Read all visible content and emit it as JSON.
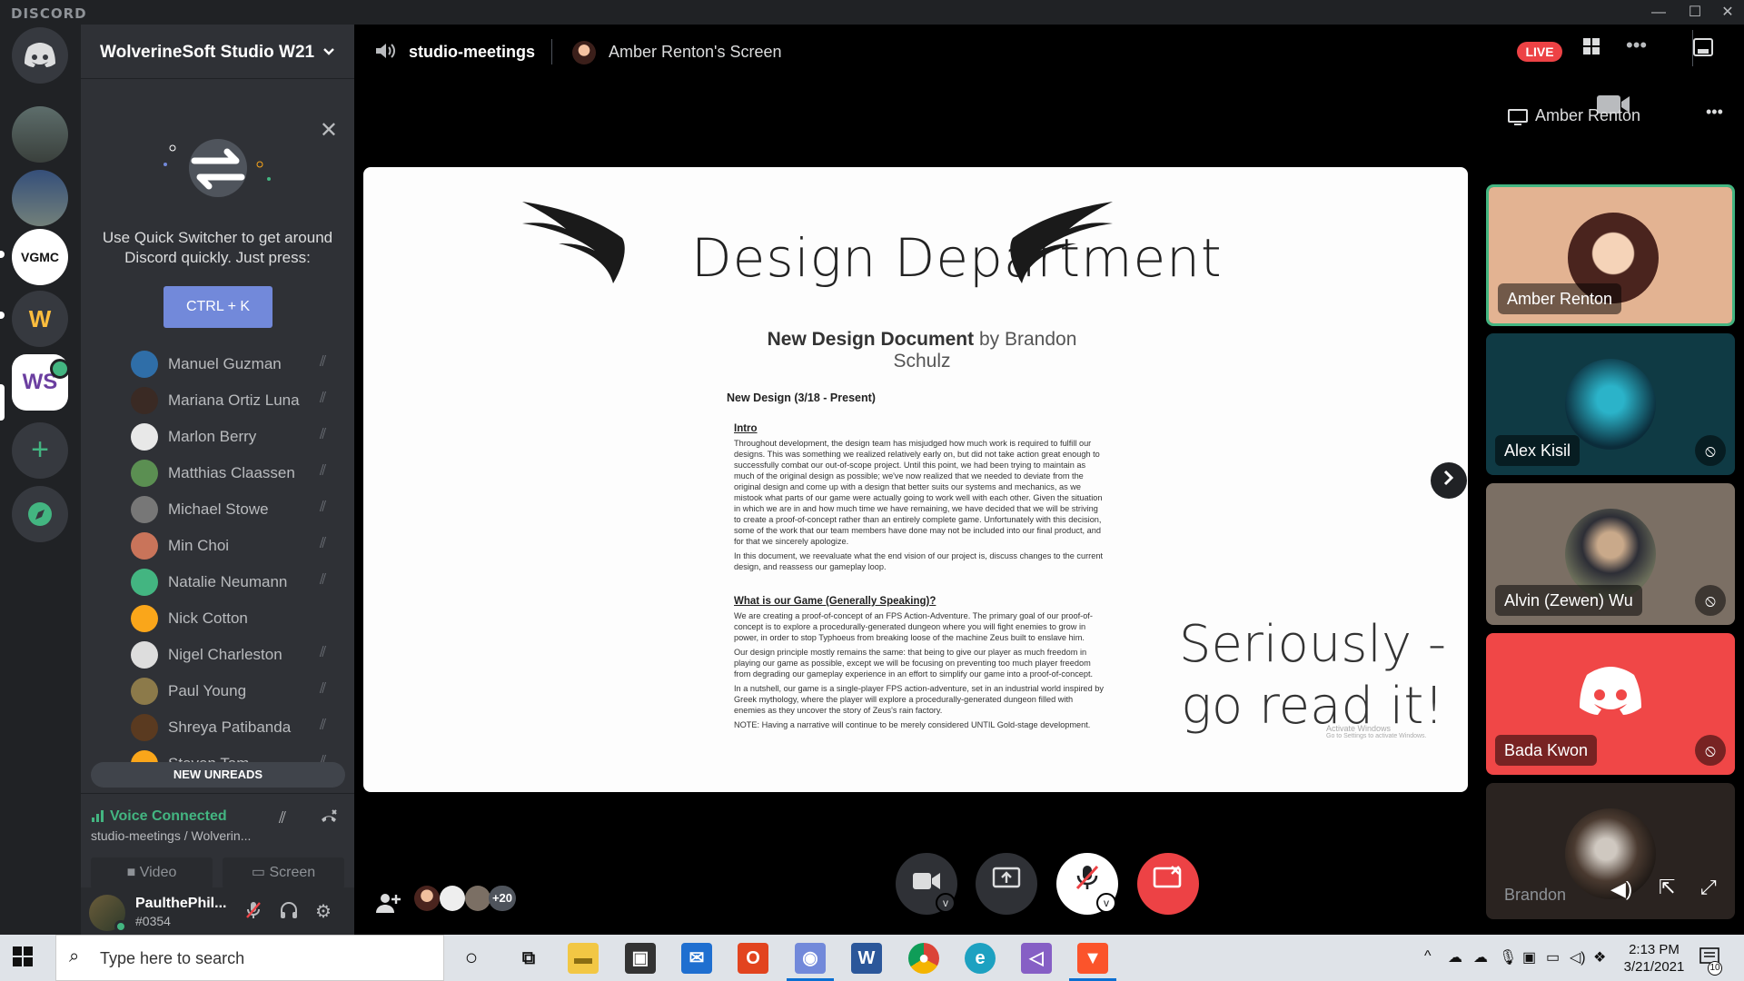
{
  "window": {
    "app_logo": "DISCORD",
    "minimize": "—",
    "maximize": "☐",
    "close": "✕"
  },
  "guilds": [
    "Discord Home",
    "Server 1",
    "Server 2",
    "VGMC",
    "WS",
    "WolverineSoft Studio",
    "Add a Server",
    "Explore"
  ],
  "server": {
    "name": "WolverineSoft Studio W21"
  },
  "quick_switcher": {
    "text": "Use Quick Switcher to get around Discord quickly. Just press:",
    "button": "CTRL + K"
  },
  "members": [
    {
      "name": "Manuel Guzman",
      "muted": true,
      "color": "#2f6ea8"
    },
    {
      "name": "Mariana Ortiz Luna",
      "muted": true,
      "color": "#3a2a24"
    },
    {
      "name": "Marlon Berry",
      "muted": true,
      "color": "#e8e8e8"
    },
    {
      "name": "Matthias Claassen",
      "muted": true,
      "color": "#5b8f52"
    },
    {
      "name": "Michael Stowe",
      "muted": true,
      "color": "#777777"
    },
    {
      "name": "Min Choi",
      "muted": true,
      "color": "#c9745a"
    },
    {
      "name": "Natalie Neumann",
      "muted": true,
      "color": "#43b581"
    },
    {
      "name": "Nick Cotton",
      "muted": false,
      "color": "#faa61a"
    },
    {
      "name": "Nigel Charleston",
      "muted": true,
      "color": "#dddddd"
    },
    {
      "name": "Paul Young",
      "muted": true,
      "color": "#8c7a4a"
    },
    {
      "name": "Shreya Patibanda",
      "muted": true,
      "color": "#5a3a20"
    },
    {
      "name": "Steven Tam",
      "muted": true,
      "color": "#faa61a"
    }
  ],
  "new_unreads": "NEW UNREADS",
  "voice": {
    "status": "Voice Connected",
    "channel": "studio-meetings / Wolverin...",
    "video_btn": "Video",
    "screen_btn": "Screen"
  },
  "user": {
    "name": "PaulthePhil...",
    "tag": "#0354"
  },
  "topbar": {
    "channel": "studio-meetings",
    "screen_title": "Amber Renton's Screen",
    "live": "LIVE"
  },
  "slide": {
    "title": "Design Department",
    "doc_title_bold": "New Design Document",
    "doc_title_rest": " by Brandon Schulz",
    "doc_heading": "New Design (3/18 - Present)",
    "intro_label": "Intro",
    "intro_p1": "Throughout development, the design team has misjudged how much work is required to fulfill our designs. This was something we realized relatively early on, but did not take action great enough to successfully combat our out-of-scope project. Until this point, we had been trying to maintain as much of the original design as possible; we've now realized that we needed to deviate from the original design and come up with a design that better suits our systems and mechanics, as we mistook what parts of our game were actually going to work well with each other. Given the situation in which we are in and how much time we have remaining, we have decided that we will be striving to create a proof-of-concept rather than an entirely complete game. Unfortunately with this decision, some of the work that our team members have done may not be included into our final product, and for that we sincerely apologize.",
    "intro_p2": "In this document, we reevaluate what the end vision of our project is, discuss changes to the current design, and reassess our gameplay loop.",
    "section2": "What is our Game (Generally Speaking)?",
    "s2_p1": "We are creating a proof-of-concept of an FPS Action-Adventure. The primary goal of our proof-of-concept is to explore a procedurally-generated dungeon where you will fight enemies to grow in power, in order to stop Typhoeus from breaking loose of the machine Zeus built to enslave him.",
    "s2_p2": "Our design principle mostly remains the same: that being to give our player as much freedom in playing our game as possible, except we will be focusing on preventing too much player freedom from degrading our gameplay experience in an effort to simplify our game into a proof-of-concept.",
    "s2_p3": "In a nutshell, our game is a single-player FPS action-adventure, set in an industrial world inspired by Greek mythology, where the player will explore a procedurally-generated dungeon filled with enemies as they uncover the story of Zeus's rain factory.",
    "s2_note": "NOTE: Having a narrative will continue to be merely considered UNTIL Gold-stage development.",
    "seriously": "Seriously - go read it!",
    "watermark_1": "Activate Windows",
    "watermark_2": "Go to Settings to activate Windows."
  },
  "sidebar_stream": {
    "title": "Amber Renton"
  },
  "tiles": [
    {
      "name": "Amber Renton",
      "muted": false,
      "bg": "#e3b392"
    },
    {
      "name": "Alex Kisil",
      "muted": true,
      "bg": "#0f3a44"
    },
    {
      "name": "Alvin (Zewen) Wu",
      "muted": true,
      "bg": "#7b6f64"
    },
    {
      "name": "Bada Kwon",
      "muted": true,
      "bg": "#f04747"
    },
    {
      "name": "Brandon",
      "muted": true,
      "bg": "#2a2320"
    }
  ],
  "call": {
    "extra_participants": "+20"
  },
  "taskbar": {
    "search_placeholder": "Type here to search",
    "time": "2:13 PM",
    "date": "3/21/2021",
    "notification_count": "10"
  }
}
